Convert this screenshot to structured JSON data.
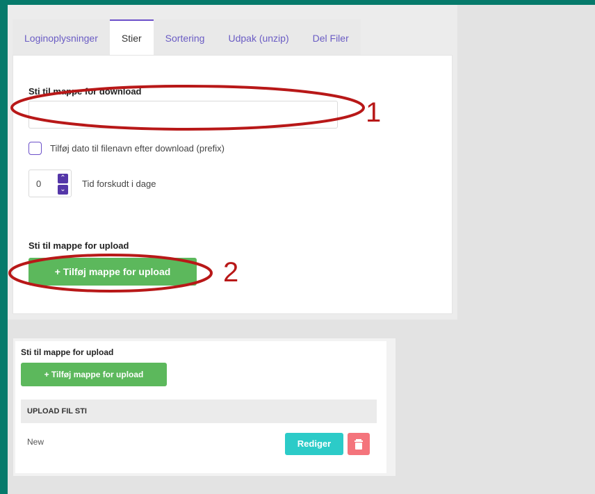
{
  "panel1": {
    "tabs": [
      {
        "label": "Loginoplysninger"
      },
      {
        "label": "Stier"
      },
      {
        "label": "Sortering"
      },
      {
        "label": "Udpak (unzip)"
      },
      {
        "label": "Del Filer"
      }
    ],
    "active_tab": "Stier",
    "download_section_label": "Sti til mappe for download",
    "download_path_value": "",
    "prefix_checkbox_label": "Tilføj dato til filenavn efter download (prefix)",
    "prefix_checked": false,
    "days_offset_value": "0",
    "days_offset_label": "Tid forskudt i dage",
    "upload_section_label": "Sti til mappe for upload",
    "add_upload_button_label": "+ Tilføj mappe for upload"
  },
  "annotations": {
    "marker_1": "1",
    "marker_2": "2",
    "color": "#b81818"
  },
  "panel2": {
    "upload_section_label": "Sti til mappe for upload",
    "add_upload_button_label": "+ Tilføj mappe for upload",
    "table_header": "UPLOAD FIL STI",
    "rows": [
      {
        "path": "New",
        "edit_label": "Rediger",
        "delete_icon": "trash-icon"
      }
    ]
  },
  "colors": {
    "frame": "#067a6b",
    "accent": "#6b4fc9",
    "green_button": "#5cb85c",
    "teal_button": "#2ccbc8",
    "red_button": "#f4747c"
  }
}
